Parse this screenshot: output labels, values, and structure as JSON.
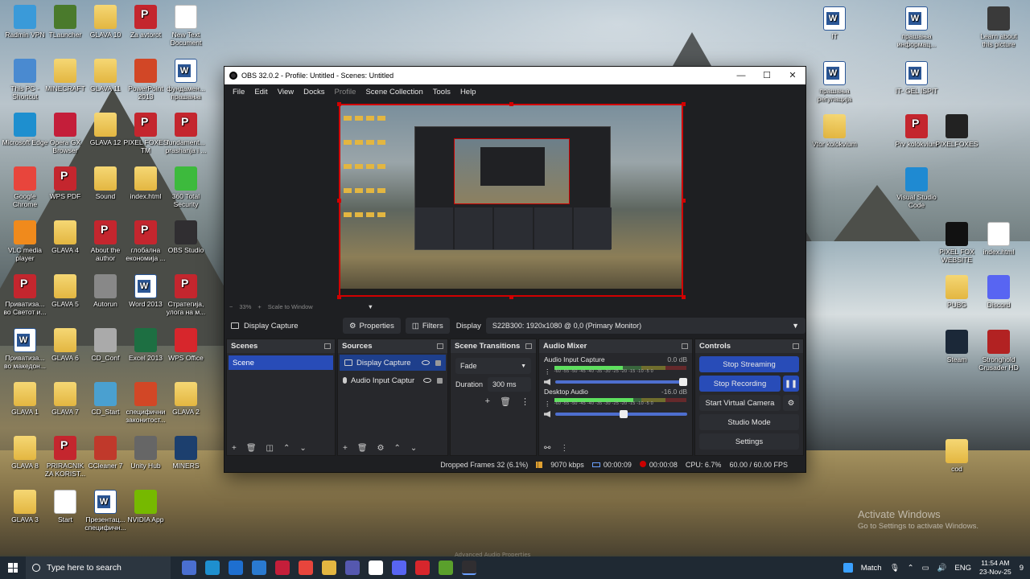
{
  "desktop": {
    "icons_left": [
      {
        "label": "Radmin VPN",
        "type": "app",
        "color": "#3a9ad9"
      },
      {
        "label": "TLauncher",
        "type": "app",
        "color": "#4a7a2c"
      },
      {
        "label": "GLAVA 10",
        "type": "folder"
      },
      {
        "label": "Za avtorot",
        "type": "pdf"
      },
      {
        "label": "New Text Document",
        "type": "doc"
      },
      {
        "label": "This PC - Shortcut",
        "type": "app",
        "color": "#4a8ad0"
      },
      {
        "label": "MINECRAFT",
        "type": "folder"
      },
      {
        "label": "GLAVA 11",
        "type": "folder"
      },
      {
        "label": "PowerPoint 2013",
        "type": "ppt"
      },
      {
        "label": "фундамен... прашања",
        "type": "word"
      },
      {
        "label": "Microsoft Edge",
        "type": "app",
        "color": "#1e8fcf"
      },
      {
        "label": "Opera GX Browser",
        "type": "app",
        "color": "#c41e3a"
      },
      {
        "label": "GLAVA 12",
        "type": "folder"
      },
      {
        "label": "PIXEL FOXES TM",
        "type": "pdf"
      },
      {
        "label": "fundament... prashanja i ...",
        "type": "pdf"
      },
      {
        "label": "Google Chrome",
        "type": "app",
        "color": "#e8453c"
      },
      {
        "label": "WPS PDF",
        "type": "pdf"
      },
      {
        "label": "Sound",
        "type": "folder"
      },
      {
        "label": "index.html",
        "type": "folder"
      },
      {
        "label": "360 Total Security",
        "type": "app",
        "color": "#3dba3d"
      },
      {
        "label": "VLC media player",
        "type": "app",
        "color": "#f08a1c"
      },
      {
        "label": "GLAVA 4",
        "type": "folder"
      },
      {
        "label": "About the author",
        "type": "pdf"
      },
      {
        "label": "глобална економија ...",
        "type": "pdf"
      },
      {
        "label": "OBS Studio",
        "type": "app",
        "color": "#302e31"
      },
      {
        "label": "Приватиза... во Светот и...",
        "type": "pdf"
      },
      {
        "label": "GLAVA 5",
        "type": "folder"
      },
      {
        "label": "Autorun",
        "type": "app",
        "color": "#888888"
      },
      {
        "label": "Word 2013",
        "type": "word"
      },
      {
        "label": "Стратегија, улога на м...",
        "type": "pdf"
      },
      {
        "label": "Приватиза... во македон...",
        "type": "word"
      },
      {
        "label": "GLAVA 6",
        "type": "folder"
      },
      {
        "label": "CD_Conf",
        "type": "app",
        "color": "#aaaaaa"
      },
      {
        "label": "Excel 2013",
        "type": "excel"
      },
      {
        "label": "WPS Office",
        "type": "app",
        "color": "#d7262c"
      },
      {
        "label": "GLAVA 1",
        "type": "folder"
      },
      {
        "label": "GLAVA 7",
        "type": "folder"
      },
      {
        "label": "CD_Start",
        "type": "app",
        "color": "#4aa0d0"
      },
      {
        "label": "специфични законитост...",
        "type": "ppt"
      },
      {
        "label": "GLAVA 2",
        "type": "folder"
      },
      {
        "label": "GLAVA 8",
        "type": "folder"
      },
      {
        "label": "PRIRACNIK ZA KORIST...",
        "type": "pdf"
      },
      {
        "label": "CCleaner 7",
        "type": "app",
        "color": "#c0392b"
      },
      {
        "label": "Unity Hub",
        "type": "app",
        "color": "#666666"
      },
      {
        "label": "MINERS",
        "type": "app",
        "color": "#1c3f6e"
      },
      {
        "label": "GLAVA 3",
        "type": "folder"
      },
      {
        "label": "Start",
        "type": "doc"
      },
      {
        "label": "Презентац... специфичн...",
        "type": "word"
      },
      {
        "label": "NVIDIA App",
        "type": "app",
        "color": "#76b900"
      }
    ],
    "icons_right": [
      {
        "label": "IT",
        "type": "word"
      },
      {
        "label": "прашања информац...",
        "type": "word"
      },
      {
        "label": "Learn about this picture",
        "type": "app",
        "color": "#3a3a3a"
      },
      {
        "label": "прашања регулација",
        "type": "word"
      },
      {
        "label": "IT- GEL ISPIT",
        "type": "word"
      },
      {
        "label": "Vtor kolokvium",
        "type": "folder"
      },
      {
        "label": "Prv kolokvium",
        "type": "pdf"
      },
      {
        "label": "PIXELFOXES",
        "type": "app",
        "color": "#222222"
      },
      {
        "label": "Visual Studio Code",
        "type": "app",
        "color": "#1f8ad2"
      },
      {
        "label": "PIXEL FOX WEBSITE",
        "type": "app",
        "color": "#111111"
      },
      {
        "label": "index.html",
        "type": "doc"
      },
      {
        "label": "PUBG",
        "type": "folder"
      },
      {
        "label": "Discord",
        "type": "app",
        "color": "#5865f2"
      },
      {
        "label": "Steam",
        "type": "app",
        "color": "#1b2838"
      },
      {
        "label": "Stronghold Crusader HD",
        "type": "app",
        "color": "#b22222"
      },
      {
        "label": "cod",
        "type": "folder"
      }
    ]
  },
  "obs": {
    "title": "OBS 32.0.2 - Profile: Untitled - Scenes: Untitled",
    "window_buttons": {
      "minimize": "—",
      "maximize": "☐",
      "close": "✕"
    },
    "menu": [
      "File",
      "Edit",
      "View",
      "Docks",
      "Profile",
      "Scene Collection",
      "Tools",
      "Help"
    ],
    "menu_dimmed": "Profile",
    "zoom": {
      "minus": "−",
      "value": "33%",
      "plus": "+",
      "mode": "Scale to Window",
      "arrow": "▼"
    },
    "selected_source": "Display Capture",
    "properties_label": "Properties",
    "filters_label": "Filters",
    "display_label": "Display",
    "display_value": "S22B300: 1920x1080 @ 0,0 (Primary Monitor)",
    "docks": {
      "scenes": {
        "title": "Scenes",
        "items": [
          "Scene"
        ]
      },
      "sources": {
        "title": "Sources",
        "items": [
          {
            "name": "Display Capture",
            "kind": "monitor"
          },
          {
            "name": "Audio Input Captur",
            "kind": "mic"
          }
        ]
      },
      "transitions": {
        "title": "Scene Transitions",
        "transition": "Fade",
        "duration_label": "Duration",
        "duration_value": "300 ms"
      },
      "mixer": {
        "title": "Audio Mixer",
        "channels": [
          {
            "name": "Audio Input Capture",
            "db": "0.0 dB",
            "level": 0.52,
            "volume": 1.0
          },
          {
            "name": "Desktop Audio",
            "db": "-16.0 dB",
            "level": 0.6,
            "volume": 0.55
          }
        ],
        "scale": "-60 -55 -50 -45 -40 -35 -30 -25 -20 -15 -10 -5 0"
      },
      "controls": {
        "title": "Controls",
        "stop_streaming": "Stop Streaming",
        "stop_recording": "Stop Recording",
        "pause_icon": "❚❚",
        "virtual_camera": "Start Virtual Camera",
        "gear_icon": "⚙",
        "studio_mode": "Studio Mode",
        "settings": "Settings"
      }
    },
    "status": {
      "dropped_frames": "Dropped Frames 32 (6.1%)",
      "bitrate": "9070 kbps",
      "stream_time": "00:00:09",
      "rec_time": "00:00:08",
      "cpu": "CPU: 6.7%",
      "fps": "60.00 / 60.00 FPS"
    }
  },
  "watermark": {
    "line1": "Activate Windows",
    "line2": "Go to Settings to activate Windows."
  },
  "ghost_tooltip": "Advanced Audio Properties",
  "taskbar": {
    "search_placeholder": "Type here to search",
    "apps": [
      {
        "name": "task-view",
        "color": "#4a6fd0"
      },
      {
        "name": "edge",
        "color": "#1e8fcf"
      },
      {
        "name": "outlook",
        "color": "#1e6fd0"
      },
      {
        "name": "store",
        "color": "#2a7ad0"
      },
      {
        "name": "opera",
        "color": "#c41e3a"
      },
      {
        "name": "chrome",
        "color": "#e8453c"
      },
      {
        "name": "explorer",
        "color": "#e3b641"
      },
      {
        "name": "teams",
        "color": "#5558af"
      },
      {
        "name": "notepad",
        "color": "#ffffff"
      },
      {
        "name": "discord",
        "color": "#5865f2"
      },
      {
        "name": "wps",
        "color": "#d7262c"
      },
      {
        "name": "minecraft",
        "color": "#5aa02c"
      },
      {
        "name": "obs",
        "color": "#302e31"
      }
    ],
    "weather": "Match",
    "lang": "ENG",
    "time": "11:54 AM",
    "date": "23-Nov-25",
    "notification_count": "9"
  }
}
